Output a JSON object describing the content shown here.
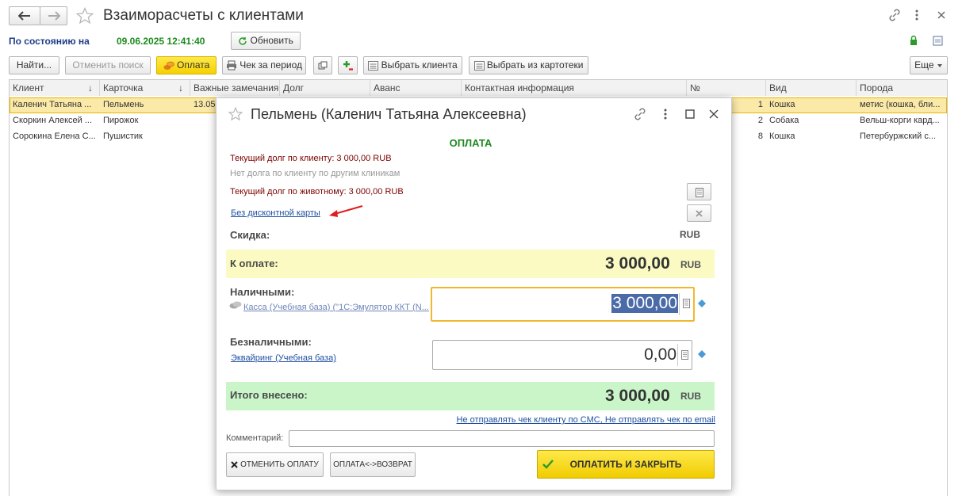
{
  "window": {
    "title": "Взаиморасчеты с клиентами"
  },
  "status": {
    "label": "По состоянию на",
    "datetime": "09.06.2025 12:41:40",
    "refresh_label": "Обновить"
  },
  "toolbar": {
    "find": "Найти...",
    "cancel_search": "Отменить поиск",
    "payment": "Оплата",
    "receipt_period": "Чек за период",
    "select_client": "Выбрать клиента",
    "select_from_card": "Выбрать из картотеки",
    "more": "Еще"
  },
  "table": {
    "columns": [
      "Клиент",
      "Карточка",
      "Важные замечания",
      "Долг",
      "Аванс",
      "Контактная информация",
      "№",
      "Вид",
      "Порода"
    ],
    "rows": [
      {
        "client": "Каленич Татьяна ...",
        "card": "Пельмень",
        "notes": "13.05",
        "num": "1",
        "kind": "Кошка",
        "breed": "метис (кошка, бли..."
      },
      {
        "client": "Скоркин Алексей ...",
        "card": "Пирожок",
        "notes": "",
        "num": "2",
        "kind": "Собака",
        "breed": "Вельш-корги кард..."
      },
      {
        "client": "Сорокина Елена С...",
        "card": "Пушистик",
        "notes": "",
        "num": "8",
        "kind": "Кошка",
        "breed": "Петербуржский с..."
      }
    ]
  },
  "dialog": {
    "title": "Пельмень (Каленич Татьяна Алексеевна)",
    "heading": "ОПЛАТА",
    "debt_client": "Текущий долг по клиенту: 3 000,00 RUB",
    "no_debt_other": "Нет долга по клиенту по другим клиникам",
    "debt_animal": "Текущий долг по животному: 3 000,00 RUB",
    "discount_link": "Без дисконтной карты",
    "discount_label": "Скидка:",
    "discount_currency": "RUB",
    "to_pay_label": "К оплате:",
    "to_pay_value": "3 000,00",
    "to_pay_currency": "RUB",
    "cash_label": "Наличными:",
    "cash_register_link": "Касса (Учебная база) (\"1С:Эмулятор ККТ (N...",
    "cash_value": "3 000,00",
    "noncash_label": "Безналичными:",
    "acquiring_link": "Эквайринг (Учебная база)",
    "noncash_value": "0,00",
    "total_label": "Итого внесено:",
    "total_value": "3 000,00",
    "total_currency": "RUB",
    "sms_link": "Не отправлять чек клиенту по СМС, Не отправлять чек по email",
    "comment_label": "Комментарий:",
    "comment_value": "",
    "cancel_payment": "ОТМЕНИТЬ ОПЛАТУ",
    "payment_return": "ОПЛАТА<->ВОЗВРАТ",
    "pay_close": "ОПЛАТИТЬ И ЗАКРЫТЬ"
  },
  "colors": {
    "accent_yellow": "#f5d800",
    "selected_row": "#fbe9a8",
    "to_pay_band": "#fafac2",
    "total_band": "#c9f5c9",
    "green_text": "#1d8a1d",
    "dark_red_text": "#7b0000",
    "link_blue": "#1f4fa0",
    "arrow_red": "#e21d1d"
  }
}
